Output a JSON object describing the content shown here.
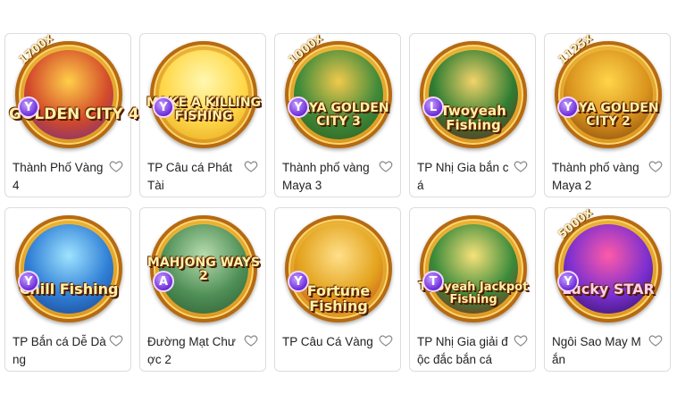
{
  "games": [
    {
      "title": "Thành Phố Vàng 4",
      "logo": "GOLDEN CITY 4",
      "mult": "1700x",
      "chip": "Y",
      "colors": [
        "#ffcf4a",
        "#d34a2a",
        "#6b2a8a"
      ]
    },
    {
      "title": "TP Câu cá Phát Tài",
      "logo": "MAKE A KILLING FISHING",
      "mult": "",
      "chip": "Y",
      "colors": [
        "#fff8b0",
        "#ffd84a",
        "#e3a21c"
      ]
    },
    {
      "title": "Thành phố vàng Maya 3",
      "logo": "MAYA GOLDEN CITY 3",
      "mult": "1000x",
      "chip": "Y",
      "colors": [
        "#f2c94c",
        "#3f8a3a",
        "#2c5a1c"
      ]
    },
    {
      "title": "TP Nhị Gia bắn cá",
      "logo": "Twoyeah Fishing",
      "mult": "",
      "chip": "L",
      "colors": [
        "#f3d36a",
        "#2e7d32",
        "#7a1f1f"
      ]
    },
    {
      "title": "Thành phố vàng Maya 2",
      "logo": "MAYA GOLDEN CITY 2",
      "mult": "1125x",
      "chip": "Y",
      "colors": [
        "#ffd54a",
        "#d9921d",
        "#7a3f0a"
      ]
    },
    {
      "title": "TP Bắn cá Dễ Dàng",
      "logo": "Chill Fishing",
      "mult": "",
      "chip": "Y",
      "colors": [
        "#9fe3ff",
        "#2f7fd6",
        "#1a3f8a"
      ]
    },
    {
      "title": "Đường Mạt Chược 2",
      "logo": "MAHJONG WAYS 2",
      "mult": "",
      "chip": "A",
      "colors": [
        "#b9ddb0",
        "#4f8f56",
        "#2d5a33"
      ]
    },
    {
      "title": "TP Câu Cá Vàng",
      "logo": "Fortune Fishing",
      "mult": "",
      "chip": "Y",
      "colors": [
        "#ffe08a",
        "#e3a21c",
        "#c2402a"
      ]
    },
    {
      "title": "TP Nhị Gia giải độc đắc bắn cá",
      "logo": "Twoyeah Jackpot Fishing",
      "mult": "",
      "chip": "T",
      "colors": [
        "#f7e27a",
        "#3a8a3a",
        "#8a1f1f"
      ]
    },
    {
      "title": "Ngôi Sao May Mắn",
      "logo": "Lucky STAR",
      "mult": "5000x",
      "chip": "Y",
      "colors": [
        "#ff5aa8",
        "#7b2fd0",
        "#2a0f5a"
      ]
    }
  ]
}
